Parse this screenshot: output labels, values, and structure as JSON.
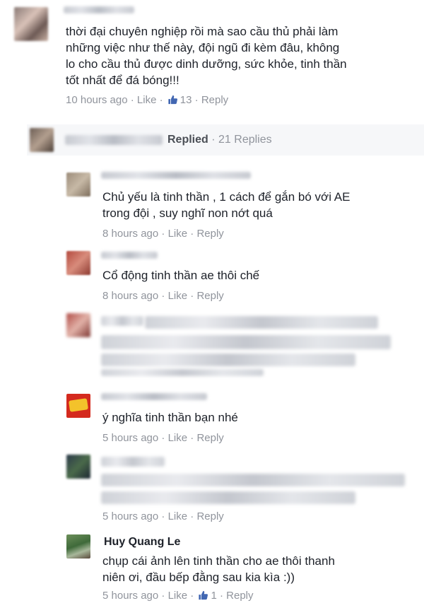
{
  "top_comment": {
    "text_lines": [
      "thời đại chuyên nghiệp rồi mà sao cầu thủ phải làm",
      "những việc như thế này, đội ngũ đi kèm đâu, không",
      "lo cho cầu thủ được dinh dưỡng, sức khỏe, tinh thần",
      "tốt nhất để đá bóng!!!"
    ],
    "time": "10 hours ago",
    "like_label": "Like",
    "like_count": "13",
    "reply_label": "Reply"
  },
  "replied_summary": {
    "label": "Replied",
    "count": "21 Replies"
  },
  "replies": [
    {
      "text_lines": [
        "Chủ yếu là tinh thần , 1 cách để gắn bó với AE",
        "trong đội , suy nghĩ  non nớt quá"
      ],
      "time": "8 hours ago",
      "like_label": "Like",
      "reply_label": "Reply"
    },
    {
      "text_lines": [
        "Cổ động tinh thần ae thôi chế"
      ],
      "time": "8 hours ago",
      "like_label": "Like",
      "reply_label": "Reply"
    },
    {
      "text_lines": [],
      "time": "",
      "like_label": "",
      "reply_label": ""
    },
    {
      "text_lines": [
        "ý nghĩa tinh thần bạn nhé"
      ],
      "time": "5 hours ago",
      "like_label": "Like",
      "reply_label": "Reply"
    },
    {
      "text_lines": [],
      "time": "5 hours ago",
      "like_label": "Like",
      "reply_label": "Reply"
    },
    {
      "name": "Huy Quang Le",
      "text_lines": [
        "chụp cái ảnh lên tinh thần cho ae thôi thanh",
        "niên ơi, đầu bếp đằng sau kia kìa :))"
      ],
      "time": "5 hours ago",
      "like_label": "Like",
      "like_count": "1",
      "reply_label": "Reply"
    }
  ],
  "separator": "·",
  "colors": {
    "text": "#1d2129",
    "meta": "#90949c",
    "link": "#4b4f56",
    "like_blue": "#4267b2",
    "bar_bg": "#f6f7f9"
  },
  "icons": {
    "like": "thumbs-up-icon"
  }
}
